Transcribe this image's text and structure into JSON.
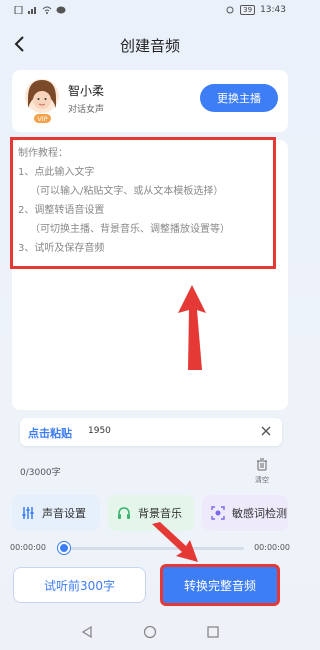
{
  "status": {
    "left_icons": [
      "sim-icon",
      "signal-icon",
      "wifi-icon",
      "chat-icon"
    ],
    "battery": "39",
    "time": "13:43"
  },
  "header": {
    "title": "创建音频"
  },
  "host": {
    "name": "智小柔",
    "desc": "对话女声",
    "badge": "VIP",
    "change_label": "更换主播"
  },
  "editor": {
    "tutorial_lines": [
      "制作教程：",
      "1、点此输入文字",
      "（可以输入/粘贴文字、或从文本模板选择）",
      "2、调整转语音设置",
      "（可切换主播、背景音乐、调整播放设置等）",
      "3、试听及保存音频"
    ]
  },
  "paste": {
    "label": "点击粘贴",
    "value": "1950"
  },
  "counter": {
    "text": "0/3000字",
    "clear_label": "清空"
  },
  "tools": [
    {
      "label": "声音设置",
      "icon": "sliders-icon",
      "bg": "#e6effc"
    },
    {
      "label": "背景音乐",
      "icon": "music-icon",
      "bg": "#e4f6ea"
    },
    {
      "label": "敏感词检测",
      "icon": "scan-icon",
      "bg": "#eeeafb"
    }
  ],
  "player": {
    "start": "00:00:00",
    "end": "00:00:00",
    "progress": 0
  },
  "actions": {
    "preview_label": "试听前300字",
    "convert_label": "转换完整音频"
  },
  "colors": {
    "accent": "#3d7df5",
    "annotation_red": "#e53935"
  }
}
